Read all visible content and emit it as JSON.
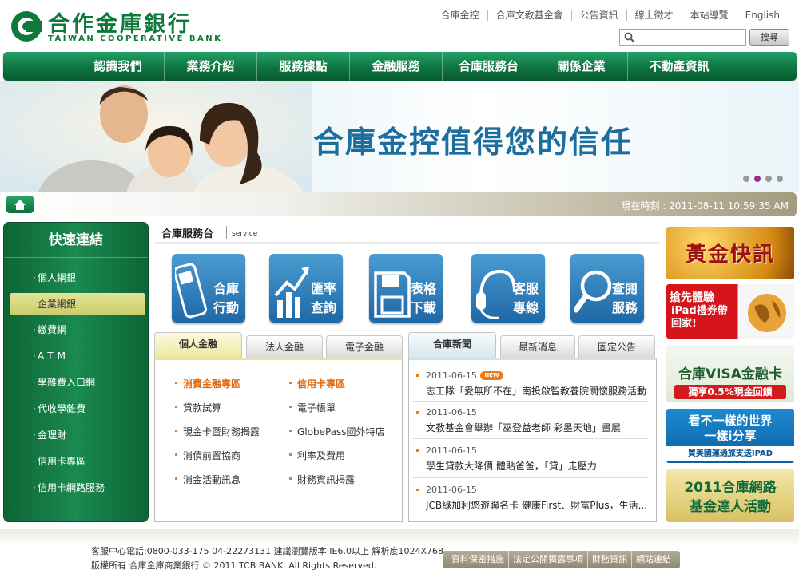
{
  "brand": {
    "name_cn": "合作金庫銀行",
    "name_en": "TAIWAN COOPERATIVE BANK",
    "color": "#0d7a3c"
  },
  "top_links": [
    "合庫金控",
    "合庫文教基金會",
    "公告資訊",
    "線上徵才",
    "本站導覽",
    "English"
  ],
  "search": {
    "placeholder": "",
    "button_label": "搜尋"
  },
  "main_nav": [
    "認識我們",
    "業務介紹",
    "服務據點",
    "金融服務",
    "合庫服務台",
    "關係企業",
    "不動產資訊"
  ],
  "banner": {
    "headline": "合庫金控值得您的信任",
    "active_slide": 2,
    "slide_count": 4
  },
  "status": {
    "clock_label": "現在時刻 : 2011-08-11  10:59:35 AM"
  },
  "sidebar": {
    "title": "快速連結",
    "items": [
      "個人網銀",
      "企業網銀",
      "繳費網",
      "ATM",
      "學雜費入口網",
      "代收學雜費",
      "金理財",
      "信用卡專區",
      "信用卡網路服務"
    ],
    "active_index": 1
  },
  "service": {
    "title": "合庫服務台",
    "subtitle": "service",
    "tiles": [
      {
        "line1": "合庫",
        "line2": "行動",
        "icon": "phone-icon"
      },
      {
        "line1": "匯率",
        "line2": "查詢",
        "icon": "chart-icon"
      },
      {
        "line1": "表格",
        "line2": "下載",
        "icon": "disk-icon"
      },
      {
        "line1": "客服",
        "line2": "專線",
        "icon": "headset-icon"
      },
      {
        "line1": "查閱",
        "line2": "服務",
        "icon": "magnifier-icon"
      }
    ]
  },
  "finance_panel": {
    "tabs": [
      "個人金融",
      "法人金融",
      "電子金融"
    ],
    "active_tab": 0,
    "left_links": [
      "消費金融專區",
      "貸款試算",
      "現金卡暨財務揭露",
      "消債前置協商",
      "消金活動訊息"
    ],
    "right_links": [
      "信用卡專區",
      "電子帳單",
      "GlobePass國外特店",
      "利率及費用",
      "財務資訊揭露"
    ]
  },
  "news_panel": {
    "tabs": [
      "合庫新聞",
      "最新消息",
      "固定公告"
    ],
    "active_tab": 0,
    "new_badge": "NEW",
    "items": [
      {
        "date": "2011-06-15",
        "title": "志工隊「愛無所不在」南投啟智教養院關懷服務活動",
        "new": true
      },
      {
        "date": "2011-06-15",
        "title": "文教基金會舉辦「巫登益老師 彩墨天地」畫展",
        "new": false
      },
      {
        "date": "2011-06-15",
        "title": "學生貸款大降價 體貼爸爸，「貸」走壓力",
        "new": false
      },
      {
        "date": "2011-06-15",
        "title": "JCB綠加利悠遊聯名卡 健康First、財富Plus，生活...",
        "new": false
      }
    ]
  },
  "ads": [
    {
      "text": "黃金快訊",
      "sub": ""
    },
    {
      "text": "搶先體驗",
      "sub": "iPad禮券帶回家!"
    },
    {
      "text": "合庫VISA金融卡",
      "sub": "獨享0.5%現金回饋"
    },
    {
      "text": "看不一樣的世界",
      "text2": "一樣i分享",
      "sub": "買美國運通旅支送IPAD"
    },
    {
      "text": "2011合庫網路",
      "text2": "基金達人活動",
      "sub": ""
    }
  ],
  "footer": {
    "line1": "客服中心電話:0800-033-175 04-22273131 建議瀏覽版本:IE6.0以上 解析度1024X768",
    "line2": "版權所有 合庫金庫商業銀行 © 2011 TCB BANK. All Rights Reserved.",
    "links": [
      "資料保密措施",
      "法定公開揭露事項",
      "財務資訊",
      "網站連結"
    ]
  }
}
